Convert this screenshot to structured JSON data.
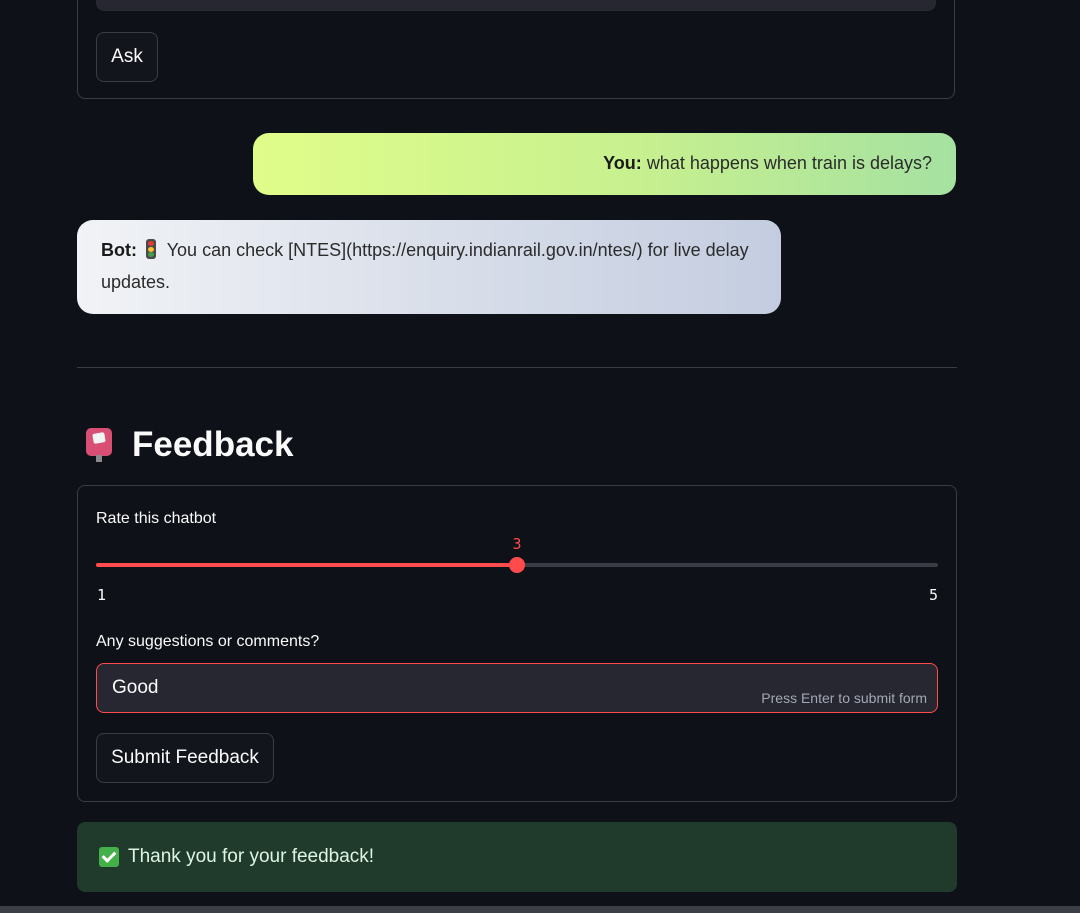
{
  "ask_form": {
    "ask_label": "Ask"
  },
  "chat": {
    "user": {
      "prefix": "You:",
      "text": "what happens when train is delays?"
    },
    "bot": {
      "prefix": "Bot:",
      "icon": "traffic-light-icon",
      "text": "You can check [NTES](https://enquiry.indianrail.gov.in/ntes/) for live delay updates."
    }
  },
  "feedback": {
    "icon": "postbox-icon",
    "title": "Feedback",
    "rating": {
      "label": "Rate this chatbot",
      "min": 1,
      "max": 5,
      "value": 3,
      "min_label": "1",
      "max_label": "5",
      "value_label": "3"
    },
    "comment": {
      "label": "Any suggestions or comments?",
      "value": "Good",
      "hint": "Press Enter to submit form"
    },
    "submit_label": "Submit Feedback"
  },
  "success": {
    "icon": "check-mark-icon",
    "text": "Thank you for your feedback!"
  },
  "colors": {
    "background": "#0e1117",
    "accent": "#ff4b4b",
    "success_bg": "#203a2b"
  }
}
